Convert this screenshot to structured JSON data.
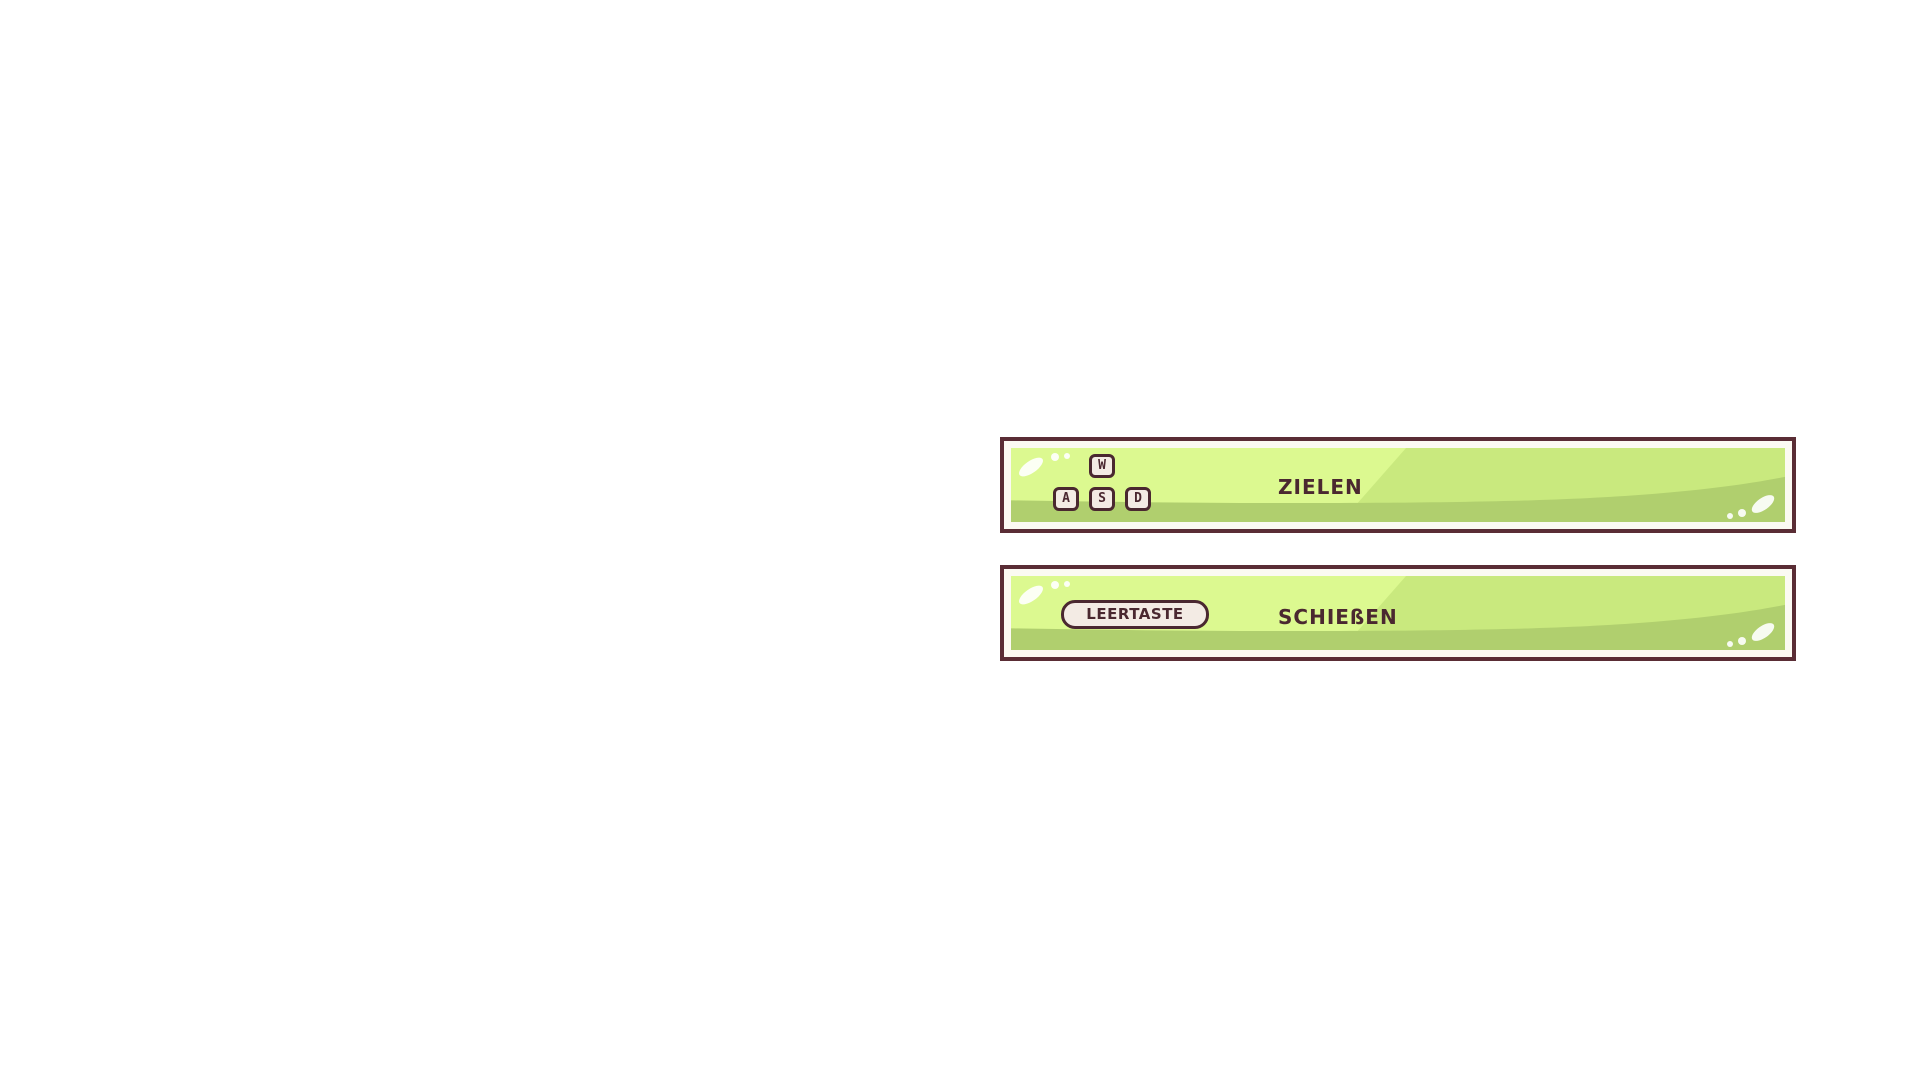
{
  "controls": [
    {
      "keys": [
        "W",
        "A",
        "S",
        "D"
      ],
      "action": "ZIELEN"
    },
    {
      "key": "LEERTASTE",
      "action": "SCHIEßEN"
    }
  ],
  "colors": {
    "border": "#5a2d35",
    "panel_light": "#dcf990",
    "panel_mid": "#c9e97e",
    "panel_dark": "#b0cf6e",
    "text": "#4a2830",
    "keycap": "#f3ebe4"
  }
}
